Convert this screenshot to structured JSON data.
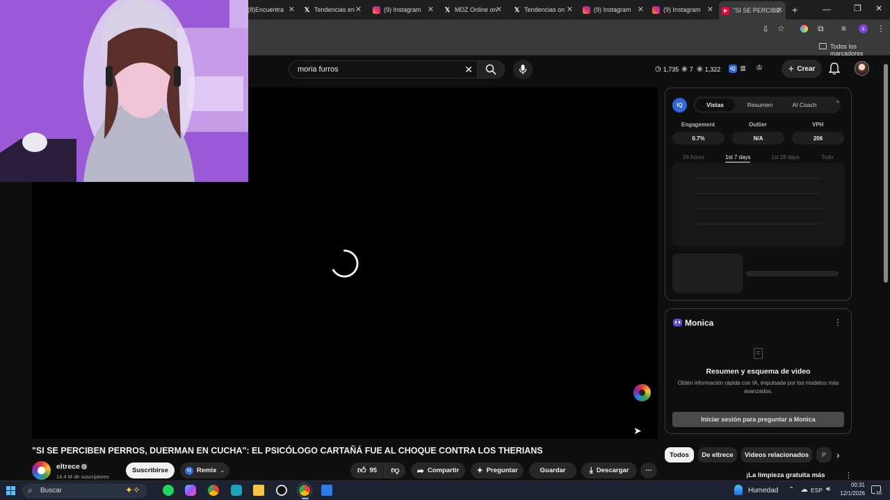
{
  "browser": {
    "tabs": [
      {
        "label": "(8)Encuentra",
        "icon": "generic-icon"
      },
      {
        "label": "Tendencias en",
        "icon": "x-icon"
      },
      {
        "label": "(9) Instagram",
        "icon": "instagram-icon"
      },
      {
        "label": "MDZ Online on",
        "icon": "x-icon"
      },
      {
        "label": "Tendencias on",
        "icon": "x-icon"
      },
      {
        "label": "(9) Instagram",
        "icon": "instagram-icon"
      },
      {
        "label": "(9) Instagram",
        "icon": "instagram-icon"
      },
      {
        "label": "\"SI SE PERCIBE",
        "icon": "youtube-icon"
      }
    ],
    "new_tab": "+",
    "bookmarks_label": "Todos los marcadores",
    "profile_initial": "s"
  },
  "youtube": {
    "search_value": "moria furros",
    "stats": {
      "views": "1,735",
      "likes": "7",
      "watch": "1,322"
    },
    "create_label": "Crear"
  },
  "panel_iq": {
    "badge": "IQ",
    "tabs": [
      "Vistas",
      "Resumen",
      "AI Coach"
    ],
    "metrics": [
      {
        "label": "Engagement",
        "value": "0.7%"
      },
      {
        "label": "Outlier",
        "value": "N/A"
      },
      {
        "label": "VPH",
        "value": "206"
      }
    ],
    "ranges": [
      "24 hours",
      "1st 7 days",
      "1st 28 days",
      "Todo"
    ]
  },
  "panel_monica": {
    "title": "Monica",
    "heading": "Resumen y esquema de video",
    "description": "Obtén información rápida con IA, impulsada por los modelos más avanzados.",
    "cta": "Iniciar sesión para preguntar a Monica"
  },
  "video": {
    "title": "\"SI SE PERCIBEN PERROS, DUERMAN EN CUCHA\": EL PSICÓLOGO CARTAÑÁ FUE AL CHOQUE CONTRA LOS THERIANS",
    "channel": "eltrece",
    "subscribers": "14.4 M de suscriptores",
    "subscribe": "Suscribirse",
    "remix": "Remix",
    "likes": "95",
    "share": "Compartir",
    "ask": "Preguntar",
    "save": "Guardar",
    "download": "Descargar"
  },
  "chips": [
    "Todos",
    "De eltrece",
    "Videos relacionados",
    "P"
  ],
  "related": {
    "first_title": "¡La limpieza gratuita más"
  },
  "taskbar": {
    "search_placeholder": "Buscar",
    "weather": "Humedad",
    "lang": "ESP",
    "time": "00:31",
    "date": "12/1/2026",
    "notif_count": "10"
  }
}
